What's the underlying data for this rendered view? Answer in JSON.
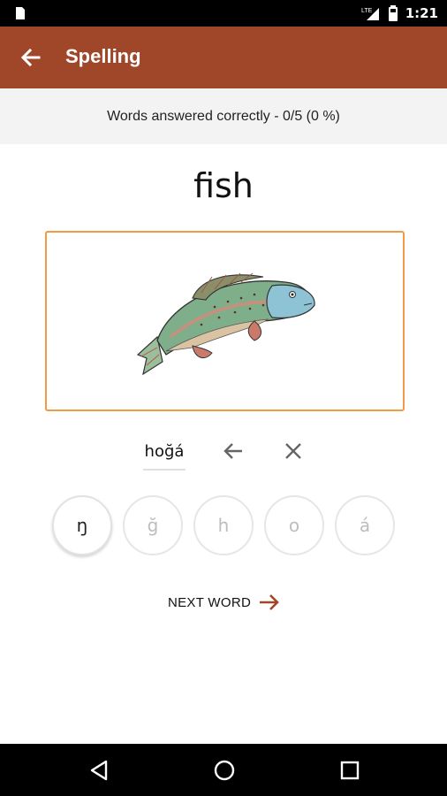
{
  "status_bar": {
    "time": "1:21",
    "network": "LTE",
    "icons": [
      "sim-card-icon",
      "signal-icon",
      "battery-icon"
    ]
  },
  "app_bar": {
    "title": "Spelling",
    "back_icon": "arrow-back-icon",
    "background_color": "#A0472A"
  },
  "score": {
    "text": "Words answered correctly - 0/5 (0 %)"
  },
  "word": {
    "text": "fish"
  },
  "image": {
    "subject": "fish-illustration",
    "border_color": "#F29A45"
  },
  "answer": {
    "value": "hoğá",
    "backspace_icon": "arrow-left-icon",
    "clear_icon": "close-icon"
  },
  "letters": [
    {
      "char": "ŋ",
      "enabled": true
    },
    {
      "char": "ğ",
      "enabled": false
    },
    {
      "char": "h",
      "enabled": false
    },
    {
      "char": "o",
      "enabled": false
    },
    {
      "char": "á",
      "enabled": false
    }
  ],
  "next_button": {
    "label": "NEXT WORD",
    "icon": "arrow-right-icon",
    "accent_color": "#A0472A"
  },
  "nav_bar": {
    "buttons": [
      "back-triangle-icon",
      "home-circle-icon",
      "recents-square-icon"
    ]
  }
}
